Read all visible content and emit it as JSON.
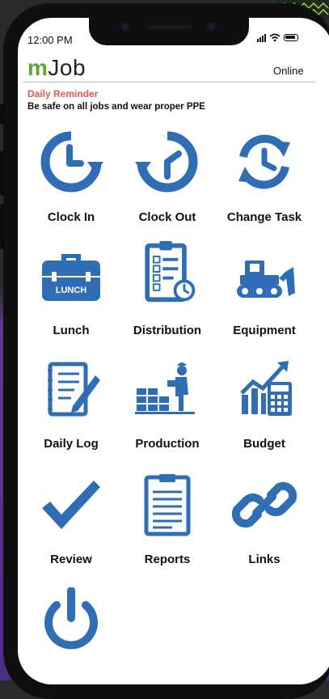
{
  "status_bar": {
    "time": "12:00 PM"
  },
  "header": {
    "logo_m": "m",
    "logo_rest": "Job",
    "status": "Online"
  },
  "reminder": {
    "title": "Daily Reminder",
    "text": "Be safe on all jobs and wear proper PPE"
  },
  "tiles": [
    {
      "label": "Clock In",
      "icon": "clock-in-icon"
    },
    {
      "label": "Clock Out",
      "icon": "clock-out-icon"
    },
    {
      "label": "Change Task",
      "icon": "change-task-icon"
    },
    {
      "label": "Lunch",
      "icon": "lunch-box-icon",
      "icon_text": "LUNCH"
    },
    {
      "label": "Distribution",
      "icon": "clipboard-checklist-icon"
    },
    {
      "label": "Equipment",
      "icon": "bulldozer-icon"
    },
    {
      "label": "Daily Log",
      "icon": "notepad-pencil-icon"
    },
    {
      "label": "Production",
      "icon": "worker-bricks-icon"
    },
    {
      "label": "Budget",
      "icon": "chart-calculator-icon"
    },
    {
      "label": "Review",
      "icon": "checkmark-icon"
    },
    {
      "label": "Reports",
      "icon": "report-clipboard-icon"
    },
    {
      "label": "Links",
      "icon": "chain-link-icon"
    },
    {
      "label": "",
      "icon": "power-icon"
    }
  ],
  "colors": {
    "icon_blue": "#2f6db5",
    "brand_green": "#5ea832",
    "reminder_red": "#e05a4f"
  }
}
